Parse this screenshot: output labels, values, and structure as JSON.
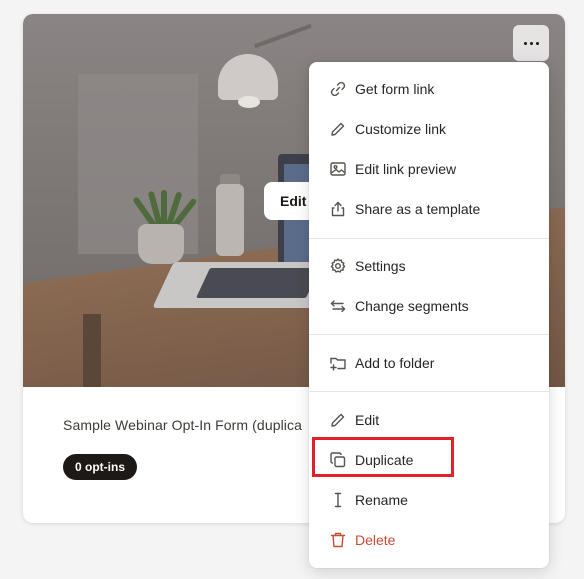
{
  "card": {
    "title": "Sample Webinar Opt-In Form (duplica",
    "badge": "0 opt-ins",
    "hover_button": "Edit"
  },
  "more_button": {
    "icon": "more-horizontal-icon"
  },
  "menu": {
    "items": [
      {
        "label": "Get form link",
        "icon": "link-icon"
      },
      {
        "label": "Customize link",
        "icon": "pencil-icon"
      },
      {
        "label": "Edit link preview",
        "icon": "image-icon"
      },
      {
        "label": "Share as a template",
        "icon": "share-icon"
      },
      {
        "label": "Settings",
        "icon": "gear-icon"
      },
      {
        "label": "Change segments",
        "icon": "arrows-swap-icon"
      },
      {
        "label": "Add to folder",
        "icon": "folder-plus-icon"
      },
      {
        "label": "Edit",
        "icon": "pencil-icon"
      },
      {
        "label": "Duplicate",
        "icon": "copy-icon"
      },
      {
        "label": "Rename",
        "icon": "text-cursor-icon"
      },
      {
        "label": "Delete",
        "icon": "trash-icon",
        "color": "#cf4a33"
      }
    ]
  },
  "colors": {
    "danger": "#cf4a33",
    "highlight": "#e0202a",
    "badge_bg": "#1c1917"
  }
}
